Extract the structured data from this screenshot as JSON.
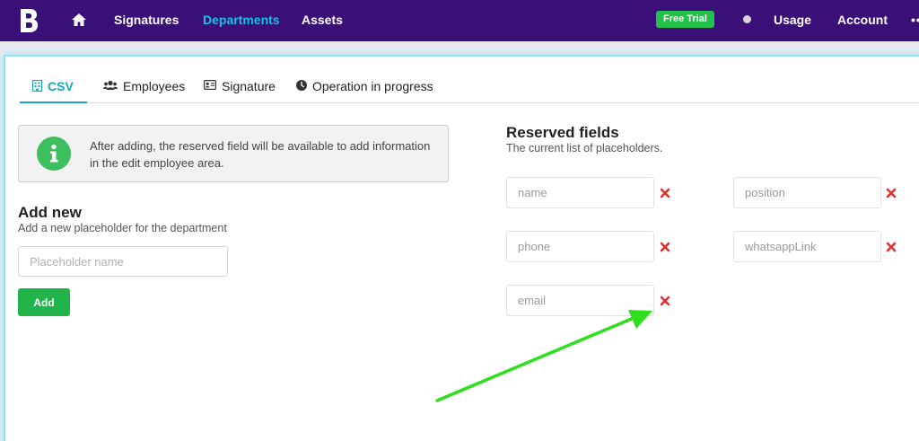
{
  "nav": {
    "logo_letter": "B",
    "links": [
      "Signatures",
      "Departments",
      "Assets"
    ],
    "badge": "Free Trial",
    "usage": "Usage",
    "account": "Account",
    "more": "••"
  },
  "tabs": [
    {
      "label": "CSV",
      "icon": "building-icon"
    },
    {
      "label": "Employees",
      "icon": "users-icon"
    },
    {
      "label": "Signature",
      "icon": "id-card-icon"
    },
    {
      "label": "Operation in progress",
      "icon": "clock-icon"
    }
  ],
  "info": {
    "icon": "info-icon",
    "text": "After adding, the reserved field will be available to add information in the edit employee area."
  },
  "add_new": {
    "title": "Add new",
    "subtitle": "Add a new placeholder for the department",
    "placeholder": "Placeholder name",
    "button": "Add"
  },
  "reserved": {
    "title": "Reserved fields",
    "subtitle": "The current list of placeholders.",
    "fields": [
      "name",
      "position",
      "phone",
      "whatsappLink",
      "email"
    ]
  },
  "colors": {
    "nav_bg": "#3b0f78",
    "active_link": "#13c2e6",
    "badge_green": "#21c14a",
    "tab_active": "#1aa7b8",
    "add_button": "#21b44b",
    "delete_red": "#e02f2f",
    "arrow_green": "#2ee01c"
  }
}
